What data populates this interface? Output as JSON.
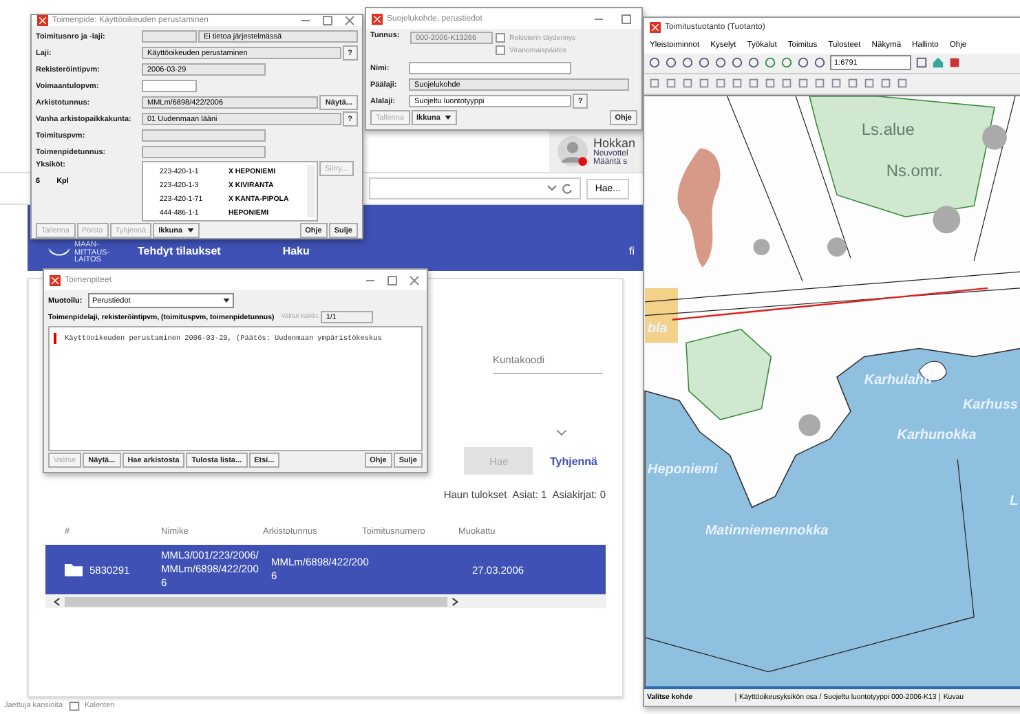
{
  "web_app": {
    "user": {
      "name": "Hokkan",
      "role": "Neuvottel",
      "link": "Määritä s"
    },
    "browser_bar": {
      "search_button": "Hae..."
    },
    "header": {
      "logo_lines": [
        "MAAN-",
        "MITTAUS-",
        "LAITOS"
      ],
      "nav": [
        "Tehdyt tilaukset",
        "Haku"
      ],
      "language": "fi"
    },
    "search_form": {
      "field_label": "Kuntakoodi",
      "search_button": {
        "label": "Hae",
        "disabled": true
      },
      "clear_link": "Tyhjennä"
    },
    "results_summary": [
      "Haun tulokset",
      "Asiat: 1",
      "Asiakirjat: 0"
    ],
    "table": {
      "columns": [
        "#",
        "Nimike",
        "Arkistotunnus",
        "Toimitusnumero",
        "Muokattu"
      ],
      "rows": [
        {
          "selected": true,
          "number": "5830291",
          "title": "MML3/001/223/2006/MMLm/6898/422/2006",
          "archive_id": "MMLm/6898/422/2006",
          "modified": "27.03.2006"
        }
      ]
    }
  },
  "taskbar": [
    "Jaettuja kansioita",
    "Kalenteri"
  ],
  "measure_window": {
    "title": "Toimenpide: Käyttöoikeuden perustaminen",
    "fields": [
      {
        "label": "Toimitusnro ja -laji:",
        "kind": "pair",
        "value": "Ei tietoa järjestelmässä"
      },
      {
        "label": "Laji:",
        "kind": "help",
        "value": "Käyttöoikeuden perustaminen",
        "button": "?"
      },
      {
        "label": "Rekisteröintipvm:",
        "kind": "text",
        "value": "2006-03-29"
      },
      {
        "label": "Voimaantulopvm:",
        "kind": "input"
      },
      {
        "label": "Arkistotunnus:",
        "kind": "help",
        "value": "MMLm/6898/422/2006",
        "button": "Näytä..."
      },
      {
        "label": "Vanha arkistopaikkakunta:",
        "kind": "help",
        "value": "01 Uudenmaan lääni",
        "button": "?"
      },
      {
        "label": "Toimituspvm:",
        "kind": "text"
      },
      {
        "label": "Toimenpidetunnus:",
        "kind": "text"
      }
    ],
    "units": {
      "label": "Yksiköt:",
      "count": "6",
      "count_unit": "Kpl",
      "button": {
        "label": "Siirry...",
        "disabled": true
      },
      "rows": [
        [
          "223-420-1-1",
          "X HEPONIEMI"
        ],
        [
          "223-420-1-3",
          "X KIVIRANTA"
        ],
        [
          "223-420-1-71",
          "X KANTA-PIPOLA"
        ],
        [
          "444-486-1-1",
          "HEPONIEMI"
        ]
      ]
    },
    "buttons_left": [
      {
        "label": "Tallenna",
        "disabled": true
      },
      {
        "label": "Poista",
        "disabled": true
      },
      {
        "label": "Tyhjennä",
        "disabled": true
      }
    ],
    "window_menu": "Ikkuna",
    "buttons_right": [
      {
        "label": "Ohje",
        "disabled": false
      },
      {
        "label": "Sulje",
        "disabled": false
      }
    ]
  },
  "protection_window": {
    "title": "Suojelukohde, perustiedot",
    "id_label": "Tunnus:",
    "id_value": "000-2006-K13266",
    "checkboxes": [
      {
        "label": "Rekisterin täydennys",
        "checked": false
      },
      {
        "label": "Viranomaispäätös",
        "checked": false
      }
    ],
    "fields": [
      {
        "label": "Nimi:",
        "kind": "input"
      },
      {
        "label": "Päälaji:",
        "kind": "text",
        "value": "Suojelukohde"
      },
      {
        "label": "Alalaji:",
        "kind": "help",
        "value": "Suojeltu luontotyyppi",
        "button": "?"
      }
    ],
    "save_button": {
      "label": "Tallenna",
      "disabled": true
    },
    "window_menu": "Ikkuna",
    "help_button": "Ohje"
  },
  "measures_window": {
    "title": "Toimenpiteet",
    "format_label": "Muotoilu:",
    "format_value": "Perustiedot",
    "list_heading": "Toimenpidelaji, rekisteröintipvm, (toimituspvm, toimenpidetunnus)",
    "selected_label": "Valitut kaikki:",
    "selected_value": "1/1",
    "lines": [
      "Käyttöoikeuden perustaminen 2006-03-29, (Päätös: Uudenmaan ympäristökeskus"
    ],
    "buttons_left": [
      {
        "label": "Valitse",
        "disabled": true
      },
      {
        "label": "Näytä...",
        "disabled": false
      },
      {
        "label": "Hae arkistosta",
        "disabled": false
      },
      {
        "label": "Tulosta lista...",
        "disabled": false
      },
      {
        "label": "Etsi...",
        "disabled": false
      }
    ],
    "buttons_right": [
      {
        "label": "Ohje",
        "disabled": false
      },
      {
        "label": "Sulje",
        "disabled": false
      }
    ]
  },
  "map_window": {
    "title": "Toimitustuotanto (Tuotanto)",
    "menu": [
      "Yleistoiminnot",
      "Kyselyt",
      "Työkalut",
      "Toimitus",
      "Tulosteet",
      "Näkymä",
      "Hallinto",
      "Ohje"
    ],
    "scale": "1:6791",
    "place_names": [
      {
        "text": "Ls.alue",
        "kind": "area"
      },
      {
        "text": "Ns.omr.",
        "kind": "area"
      },
      {
        "text": "bla",
        "kind": "water"
      },
      {
        "text": "Karhulahti",
        "kind": "water"
      },
      {
        "text": "Karhuss",
        "kind": "water"
      },
      {
        "text": "Karhunokka",
        "kind": "water"
      },
      {
        "text": "Heponiemi",
        "kind": "water"
      },
      {
        "text": "Matinniemennokka",
        "kind": "water"
      },
      {
        "text": "L",
        "kind": "water"
      }
    ],
    "status": [
      "Valitse kohde",
      "Käyttöoikeusyksikön osa / Suojeltu luontotyyppi 000-2006-K13",
      "Kuvau"
    ]
  }
}
